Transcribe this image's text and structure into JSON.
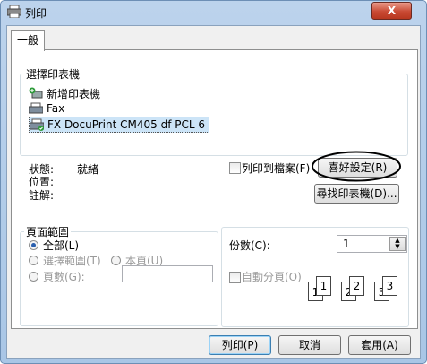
{
  "window": {
    "title": "列印",
    "close_label": "X"
  },
  "tab": {
    "label": "一般"
  },
  "select_printer": {
    "group_label": "選擇印表機",
    "printers": [
      "新增印表機",
      "Fax",
      "FX DocuPrint CM405 df PCL 6"
    ],
    "selected_index": 2
  },
  "status": {
    "status_label": "狀態:",
    "status_value": "就緒",
    "location_label": "位置:",
    "comment_label": "註解:"
  },
  "print_to_file": {
    "label": "列印到檔案(F)",
    "checked": false
  },
  "buttons": {
    "preferences": "喜好設定(R)",
    "find_printer": "尋找印表機(D)...",
    "print": "列印(P)",
    "cancel": "取消",
    "apply": "套用(A)"
  },
  "page_range": {
    "group_label": "頁面範圍",
    "all": "全部(L)",
    "selection": "選擇範圍(T)",
    "current_page": "本頁(U)",
    "pages": "頁數(G):",
    "pages_value": ""
  },
  "copies": {
    "label": "份數(C):",
    "value": "1",
    "collate_label": "自動分頁(O)",
    "collate_checked": false,
    "collate_icons": [
      "1",
      "1",
      "2",
      "2",
      "3",
      "3"
    ]
  }
}
